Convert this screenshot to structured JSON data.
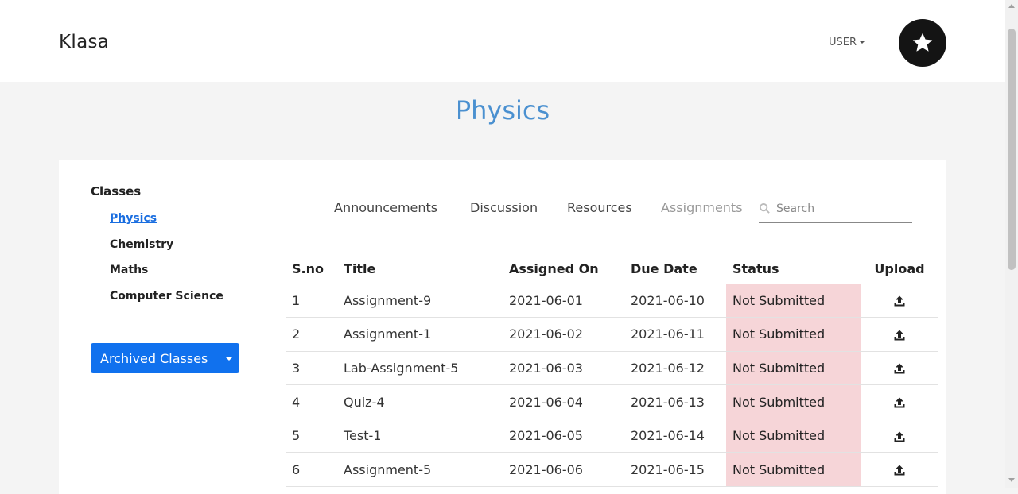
{
  "header": {
    "brand": "Klasa",
    "user_label": "USER",
    "avatar_icon": "star-icon"
  },
  "page": {
    "title": "Physics"
  },
  "sidebar": {
    "heading": "Classes",
    "classes": [
      {
        "label": "Physics",
        "active": true
      },
      {
        "label": "Chemistry",
        "active": false
      },
      {
        "label": "Maths",
        "active": false
      },
      {
        "label": "Computer Science",
        "active": false
      }
    ],
    "archived_label": "Archived Classes"
  },
  "tabs": [
    {
      "label": "Announcements"
    },
    {
      "label": "Discussion"
    },
    {
      "label": "Resources"
    },
    {
      "label": "Assignments",
      "active": true
    }
  ],
  "search": {
    "placeholder": "Search",
    "value": ""
  },
  "table": {
    "headers": {
      "sno": "S.no",
      "title": "Title",
      "assigned": "Assigned On",
      "due": "Due Date",
      "status": "Status",
      "upload": "Upload"
    },
    "rows": [
      {
        "sno": "1",
        "title": "Assignment-9",
        "assigned": "2021-06-01",
        "due": "2021-06-10",
        "status": "Not Submitted"
      },
      {
        "sno": "2",
        "title": "Assignment-1",
        "assigned": "2021-06-02",
        "due": "2021-06-11",
        "status": "Not Submitted"
      },
      {
        "sno": "3",
        "title": "Lab-Assignment-5",
        "assigned": "2021-06-03",
        "due": "2021-06-12",
        "status": "Not Submitted"
      },
      {
        "sno": "4",
        "title": "Quiz-4",
        "assigned": "2021-06-04",
        "due": "2021-06-13",
        "status": "Not Submitted"
      },
      {
        "sno": "5",
        "title": "Test-1",
        "assigned": "2021-06-05",
        "due": "2021-06-14",
        "status": "Not Submitted"
      },
      {
        "sno": "6",
        "title": "Assignment-5",
        "assigned": "2021-06-06",
        "due": "2021-06-15",
        "status": "Not Submitted"
      }
    ]
  },
  "colors": {
    "title": "#4a90d0",
    "active_link": "#1a6ee0",
    "button": "#1071ee",
    "status_bg": "#f6d5d8"
  }
}
